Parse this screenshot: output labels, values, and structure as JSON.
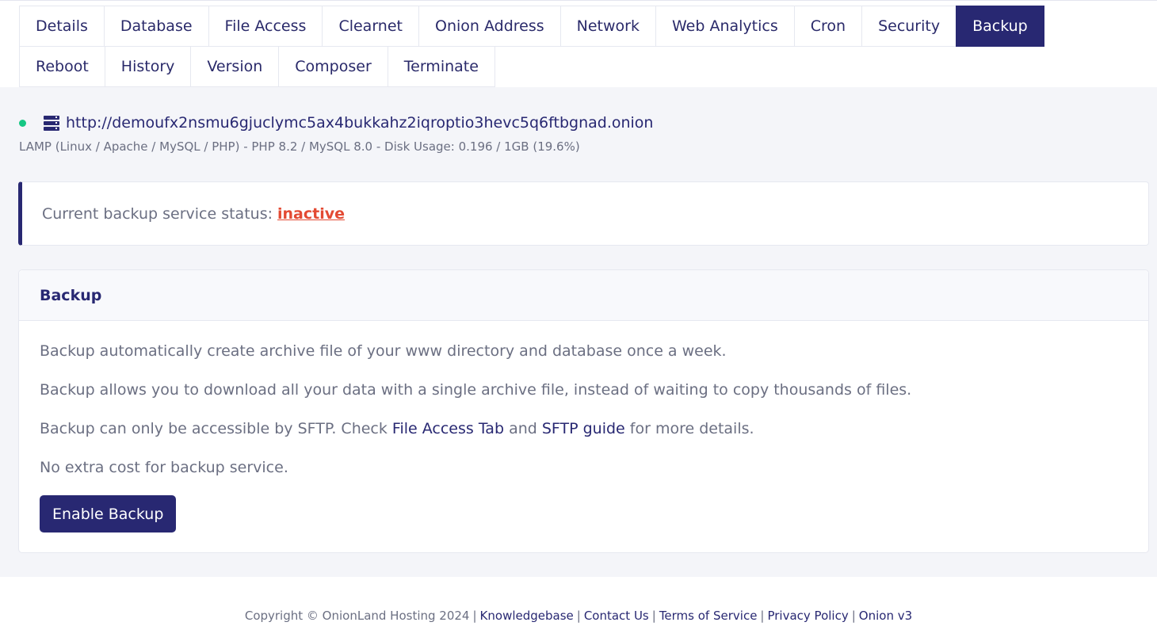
{
  "tabs": {
    "details": "Details",
    "database": "Database",
    "file_access": "File Access",
    "clearnet": "Clearnet",
    "onion_address": "Onion Address",
    "network": "Network",
    "web_analytics": "Web Analytics",
    "cron": "Cron",
    "security": "Security",
    "backup": "Backup",
    "reboot": "Reboot",
    "history": "History",
    "version": "Version",
    "composer": "Composer",
    "terminate": "Terminate",
    "active": "Backup"
  },
  "site": {
    "url": "http://demoufx2nsmu6gjuclymc5ax4bukkahz2iqroptio3hevc5q6ftbgnad.onion",
    "meta": "LAMP (Linux / Apache / MySQL / PHP) - PHP 8.2 / MySQL 8.0 - Disk Usage: 0.196 / 1GB (19.6%)",
    "status_dot_color": "#16c784",
    "server_icon": "server-icon"
  },
  "alert": {
    "label": "Current backup service status:",
    "status": "inactive",
    "status_color": "#e34a33"
  },
  "card": {
    "title": "Backup",
    "paragraph1": "Backup automatically create archive file of your www directory and database once a week.",
    "paragraph2": "Backup allows you to download all your data with a single archive file, instead of waiting to copy thousands of files.",
    "paragraph3_prefix": "Backup can only be accessible by SFTP. Check",
    "file_access_link": "File Access Tab",
    "and_text": "and",
    "sftp_link": "SFTP guide",
    "paragraph3_suffix": "for more details.",
    "paragraph4": "No extra cost for backup service.",
    "button_label": "Enable Backup"
  },
  "footer": {
    "copyright": "Copyright © OnionLand Hosting 2024",
    "separator": "|",
    "links": {
      "knowledgebase": "Knowledgebase",
      "contact": "Contact Us",
      "terms": "Terms of Service",
      "privacy": "Privacy Policy",
      "onion": "Onion v3"
    }
  },
  "colors": {
    "brand": "#282872",
    "page_bg": "#f4f5f9"
  }
}
